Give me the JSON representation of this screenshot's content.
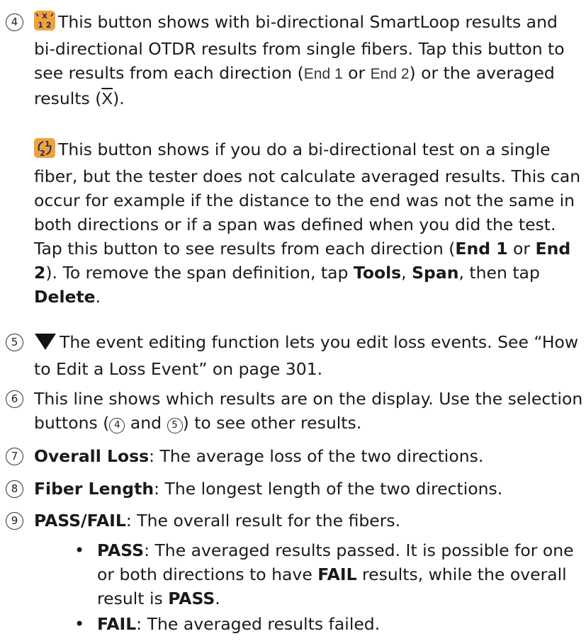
{
  "item4": {
    "num": "4",
    "p1_text": "This button shows with bi-directional SmartLoop results and bi-directional OTDR results from single fibers. Tap this button to see results from each direction (",
    "end1": "End 1",
    "or": " or ",
    "end2": "End 2",
    "p1_tail": ") or the averaged results (",
    "xbar": "X",
    "p1_close": ").",
    "icon1_top": "X",
    "icon1_bottom": "1 2",
    "p2_text": "This button shows if you do a bi-directional test on a single fiber, but the tester does not calculate averaged results. This can occur for example if the distance to the end was not the same in both directions or if a span was defined when you did the test. Tap this button to see results from each direction (",
    "p2_end1": "End 1",
    "p2_or": " or ",
    "p2_end2": "End 2",
    "p2_mid": "). To remove the span definition, tap ",
    "tools": "Tools",
    "comma": ", ",
    "span": "Span",
    "then": ", then tap ",
    "delete": "Delete",
    "period": ".",
    "icon2_top": "1",
    "icon2_bottom": "2"
  },
  "item5": {
    "num": "5",
    "text": "The event editing function lets you edit loss events. See “How to Edit a Loss Event” on page 301."
  },
  "item6": {
    "num": "6",
    "text_a": "This line shows which results are on the display. Use the selection buttons (",
    "ref4": "4",
    "and": " and ",
    "ref5": "5",
    "text_b": ") to see other results."
  },
  "item7": {
    "num": "7",
    "label": "Overall Loss",
    "text": ": The average loss of the two directions."
  },
  "item8": {
    "num": "8",
    "label": "Fiber Length",
    "text": ": The longest length of the two directions."
  },
  "item9": {
    "num": "9",
    "label": "PASS/FAIL",
    "text": ": The overall result for the fibers.",
    "bullets": [
      {
        "label": "PASS",
        "text_a": ": The averaged results passed. It is possible for one or both directions to have ",
        "fail": "FAIL",
        "text_b": " results, while the overall result is ",
        "pass": "PASS",
        "end": "."
      },
      {
        "label": "FAIL",
        "text": ": The averaged results failed."
      }
    ],
    "bullet_char": "•"
  },
  "colors": {
    "icon_bg": "#f0a23a",
    "icon_fg": "#1a2a66",
    "marker": "#111111"
  }
}
